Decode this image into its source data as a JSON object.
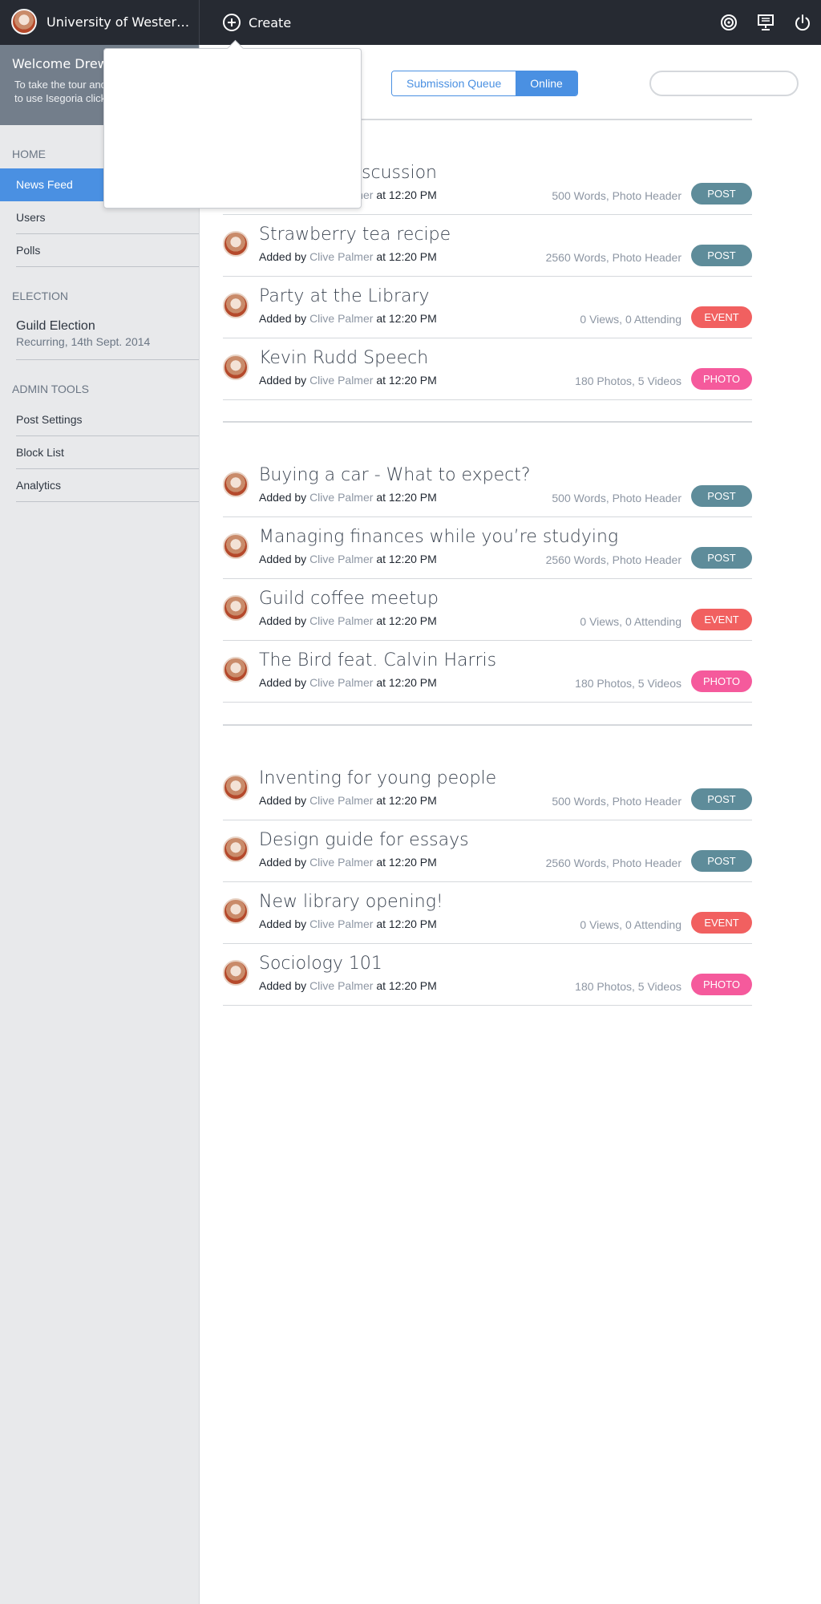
{
  "topbar": {
    "brand_name": "University of Wester…",
    "create_label": "Create",
    "icons": [
      "target-icon",
      "presentation-icon",
      "power-icon"
    ]
  },
  "sidebar": {
    "welcome_title": "Welcome Drew!",
    "welcome_text_1": "To take the tour and",
    "welcome_text_2": "to use Isegoria click",
    "sections": {
      "home": "HOME",
      "election": "ELECTION",
      "admin": "ADMIN TOOLS"
    },
    "home_items": [
      "News Feed",
      "Users",
      "Polls"
    ],
    "election_item": {
      "title": "Guild Election",
      "subtitle": "Recurring, 14th Sept. 2014"
    },
    "admin_items": [
      "Post Settings",
      "Block List",
      "Analytics"
    ]
  },
  "main": {
    "tabs": [
      "Submission Queue",
      "Online"
    ],
    "active_tab": "Online",
    "meta": {
      "prefix": "Added by",
      "author": "Clive Palmer",
      "time": "at 12:20 PM"
    },
    "groups": [
      [
        {
          "title": "Discussion",
          "stats": "500 Words, Photo Header",
          "badge": "POST"
        },
        {
          "title": "Strawberry tea recipe",
          "stats": "2560 Words, Photo Header",
          "badge": "POST"
        },
        {
          "title": "Party at the Library",
          "stats": "0 Views, 0 Attending",
          "badge": "EVENT"
        },
        {
          "title": "Kevin Rudd Speech",
          "stats": "180 Photos, 5 Videos",
          "badge": "PHOTO"
        }
      ],
      [
        {
          "title": "Buying a car - What to expect?",
          "stats": "500 Words, Photo Header",
          "badge": "POST"
        },
        {
          "title": "Managing finances while you’re studying",
          "stats": "2560 Words, Photo Header",
          "badge": "POST"
        },
        {
          "title": "Guild coffee meetup",
          "stats": "0 Views, 0 Attending",
          "badge": "EVENT"
        },
        {
          "title": "The Bird feat. Calvin Harris",
          "stats": "180 Photos, 5 Videos",
          "badge": "PHOTO"
        }
      ],
      [
        {
          "title": "Inventing for young people",
          "stats": "500 Words, Photo Header",
          "badge": "POST"
        },
        {
          "title": "Design guide for essays",
          "stats": "2560 Words, Photo Header",
          "badge": "POST"
        },
        {
          "title": "New library opening!",
          "stats": "0 Views, 0 Attending",
          "badge": "EVENT"
        },
        {
          "title": "Sociology 101",
          "stats": "180 Photos, 5 Videos",
          "badge": "PHOTO"
        }
      ]
    ]
  },
  "colors": {
    "accent": "#4a90e2",
    "post": "#5e8c9a",
    "event": "#f16060",
    "photo": "#f55a9c",
    "topbar": "#262a32"
  }
}
